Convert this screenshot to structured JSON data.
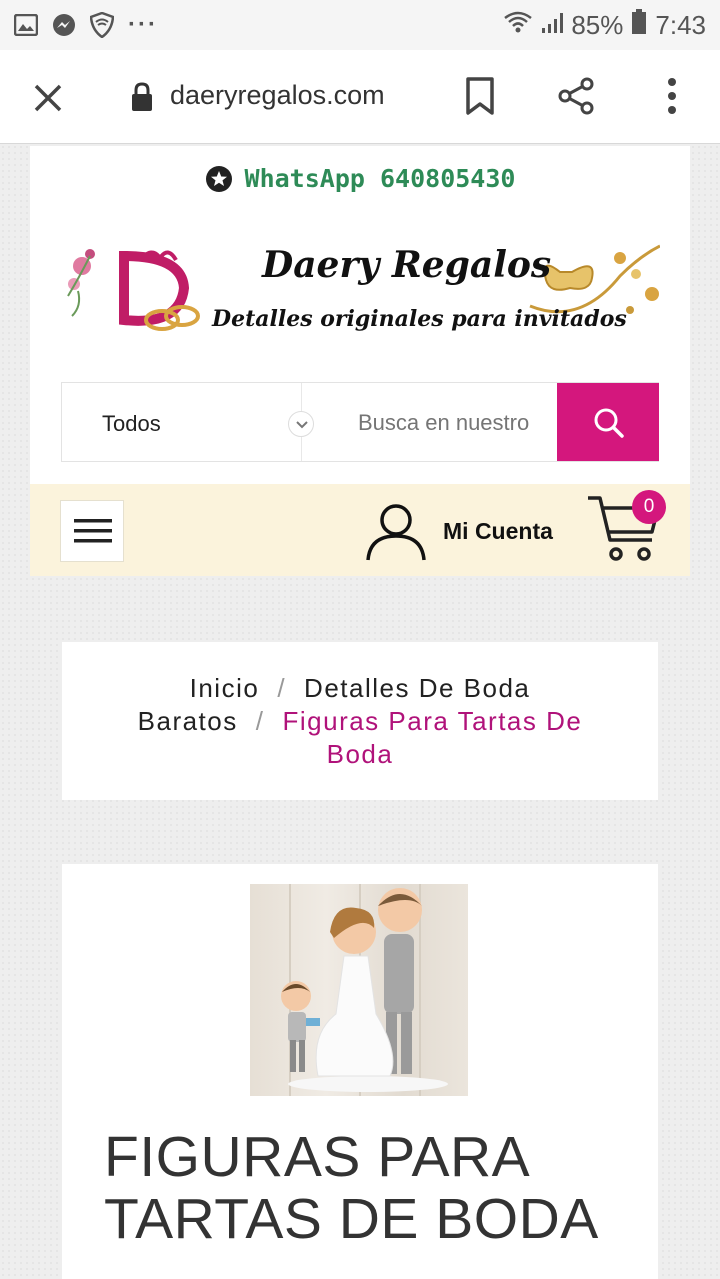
{
  "status_bar": {
    "battery": "85%",
    "time": "7:43",
    "more": "···"
  },
  "browser": {
    "url": "daeryregalos.com"
  },
  "header": {
    "whatsapp_label": "WhatsApp 640805430",
    "logo_title": "Daery Regalos",
    "logo_subtitle": "Detalles originales para invitados"
  },
  "search": {
    "category": "Todos",
    "placeholder": "Busca en nuestro"
  },
  "nav": {
    "account_label": "Mi Cuenta",
    "cart_count": "0"
  },
  "breadcrumb": {
    "home": "Inicio",
    "separator": "/",
    "parent_line1": "Detalles De Boda",
    "parent_line2": "Baratos",
    "current_line1": "Figuras Para Tartas De",
    "current_line2": "Boda"
  },
  "product": {
    "title": "FIGURAS PARA TARTAS DE BODA"
  },
  "colors": {
    "accent": "#d4177d",
    "whatsapp": "#2e8b57",
    "nav_bg": "#fbf3dc"
  }
}
